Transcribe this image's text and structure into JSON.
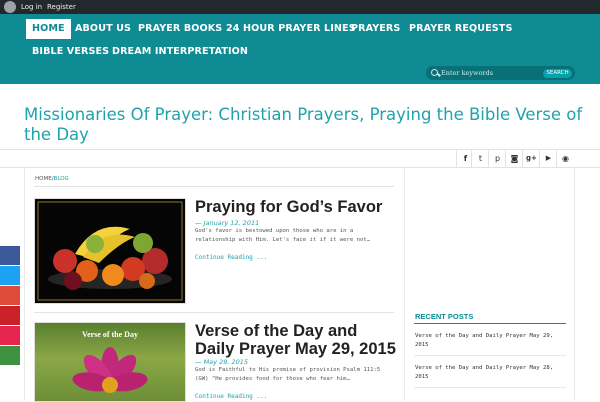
{
  "admin_bar": {
    "login": "Log in",
    "register": "Register",
    "logo_icon": "wordpress-icon"
  },
  "nav": {
    "items": [
      {
        "label": "HOME",
        "active": true
      },
      {
        "label": "ABOUT US"
      },
      {
        "label": "PRAYER BOOKS"
      },
      {
        "label": "24 HOUR PRAYER LINES"
      },
      {
        "label": "PRAYERS"
      },
      {
        "label": "PRAYER REQUESTS"
      },
      {
        "label": "BIBLE VERSES"
      },
      {
        "label": "DREAM INTERPRETATION"
      }
    ]
  },
  "search": {
    "placeholder": "Enter keywords",
    "button": "SEARCH"
  },
  "site": {
    "title": "Missionaries Of Prayer: Christian Prayers, Praying the Bible Verse of the Day"
  },
  "social_icons": [
    "facebook-icon",
    "twitter-icon",
    "pinterest-icon",
    "instagram-icon",
    "google-plus-icon",
    "youtube-icon",
    "rss-icon"
  ],
  "social_glyphs": {
    "facebook": "f",
    "twitter": "t",
    "pinterest": "p",
    "instagram": "◙",
    "google": "g+",
    "youtube": "▶",
    "rss": "◉"
  },
  "breadcrumb": {
    "home": "HOME",
    "sep": "/",
    "current": "BLOG"
  },
  "posts": [
    {
      "title": "Praying for God’s Favor",
      "date": "— January 12, 2011",
      "excerpt": "God's favor is bestowed upon those who are in a relationship with Him.  Let's face it if it were not…",
      "continue": "Continue Reading ..."
    },
    {
      "title": "Verse of the Day and Daily Prayer May 29, 2015",
      "date": "— May 29, 2015",
      "image_caption": "Verse of the Day",
      "excerpt": "God is Faithful to His promise of provision   Psalm 111:5 (GW) \"He provides food for those who fear him…",
      "continue": "Continue Reading ..."
    }
  ],
  "sidebar": {
    "recent_posts_title": "RECENT POSTS",
    "recent_posts": [
      "Verse of the Day and Daily Prayer May 29, 2015",
      "Verse of the Day and Daily Prayer May 28, 2015"
    ]
  },
  "colors": {
    "brand_teal": "#0e8b93",
    "accent": "#1fa3ad",
    "admin_bar": "#23282d"
  },
  "share_bar_colors": [
    "#3b5998",
    "#1da1f2",
    "#dd4b39",
    "#cb2027",
    "#e5254e",
    "#3f9142"
  ]
}
